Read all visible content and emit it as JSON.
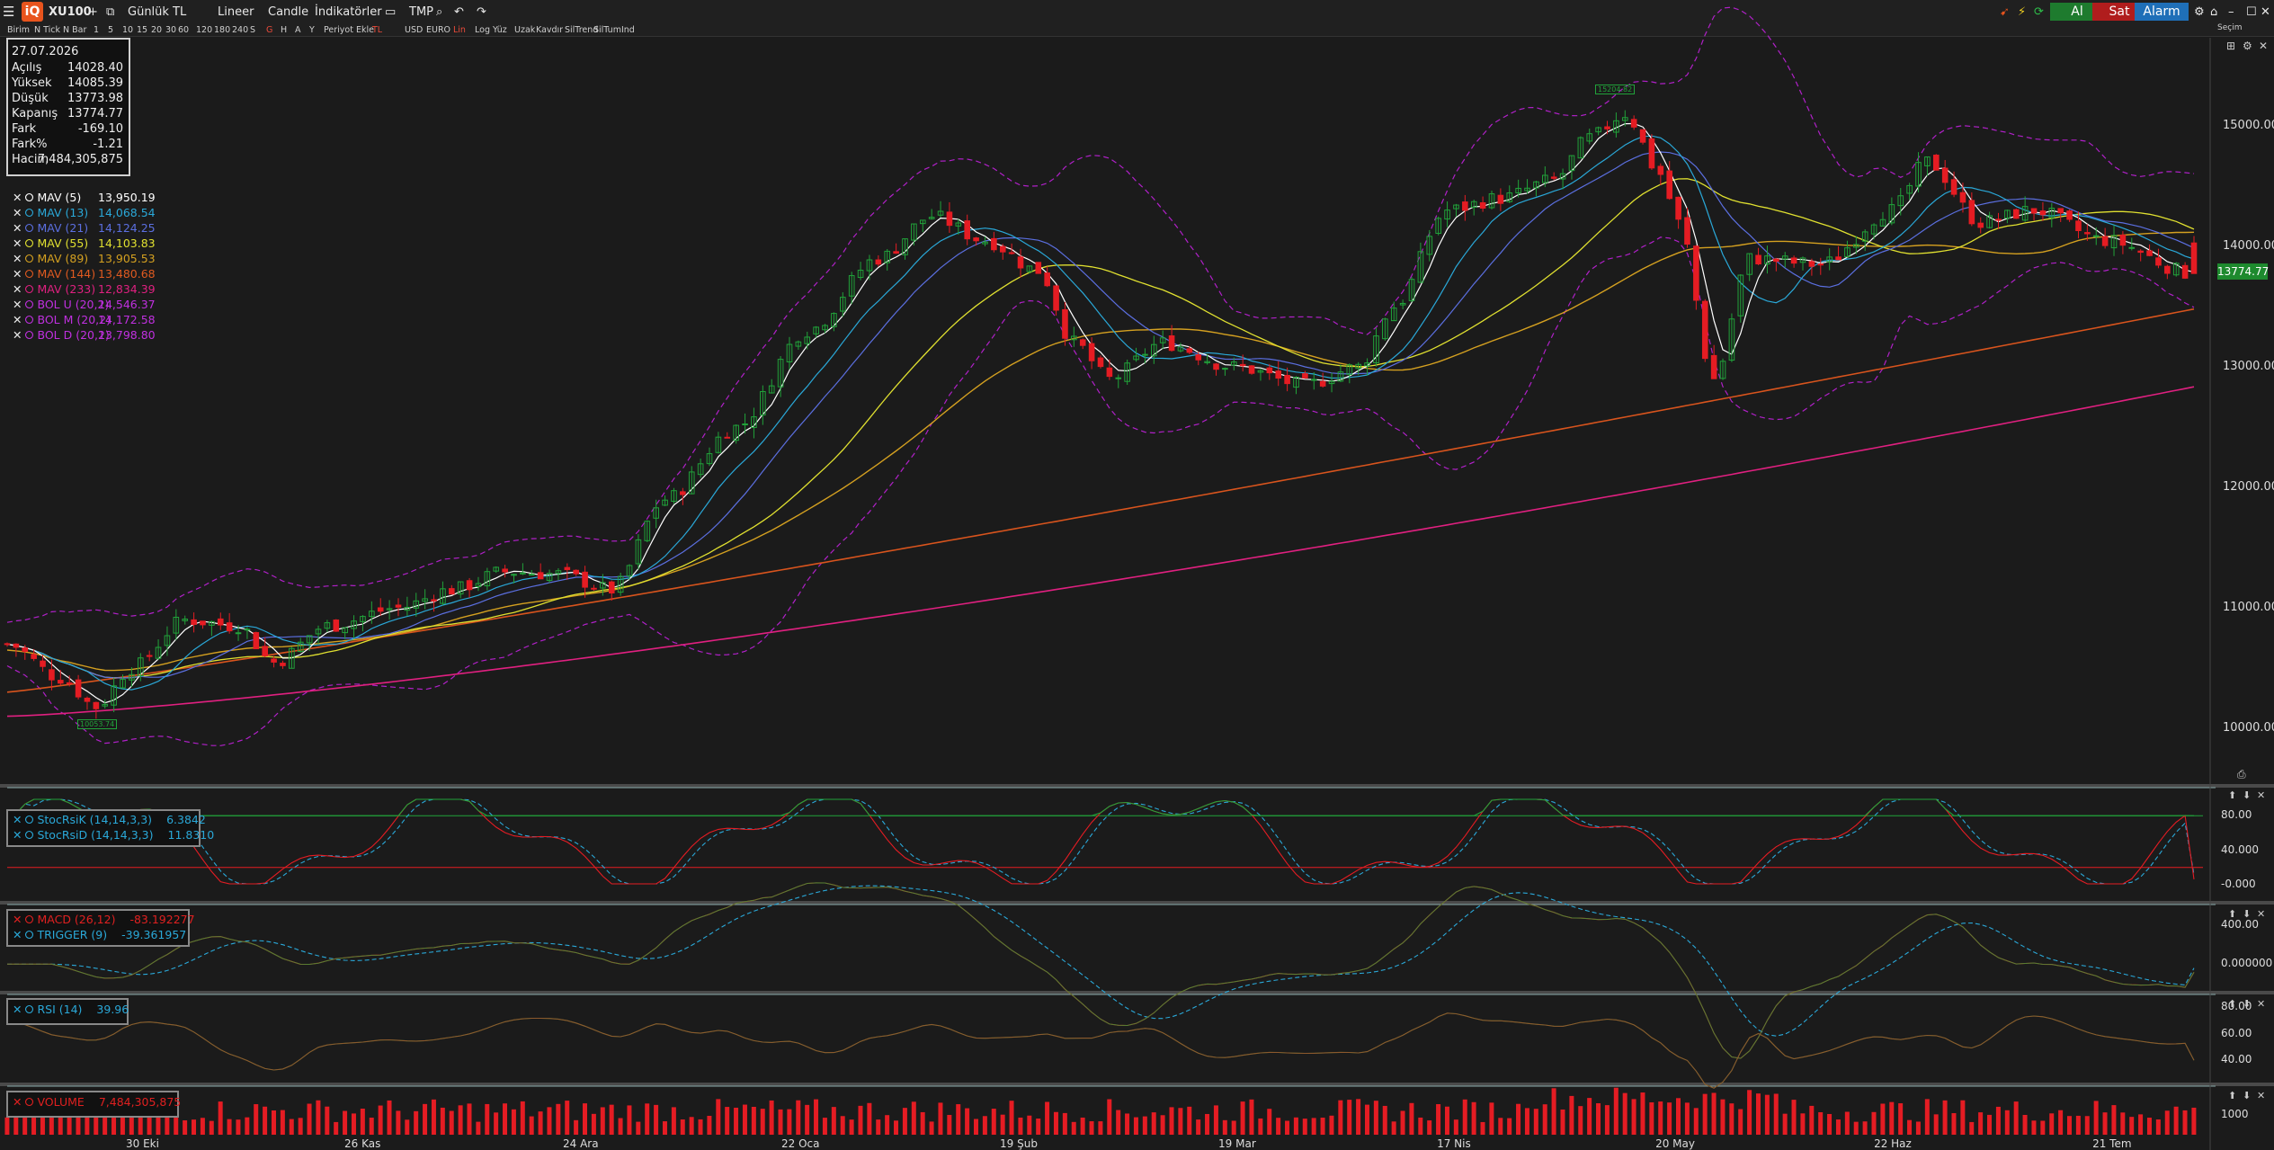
{
  "toolbar": {
    "symbol": "XU100",
    "period": "Günlük",
    "currency": "TL",
    "scale": "Lineer",
    "chart_type": "Candle",
    "indicators": "İndikatörler",
    "tmp": "TMP",
    "buy": "Al",
    "sell": "Sat",
    "alarm": "Alarm",
    "settings_label": "Seçim",
    "row2": [
      "Birim",
      "N Tick",
      "N Bar",
      "1",
      "5",
      "10",
      "15",
      "20",
      "30",
      "60",
      "120",
      "180",
      "240",
      "S",
      "G",
      "H",
      "A",
      "Y",
      "Periyot Ekle",
      "TL",
      "USD",
      "EURO",
      "Lin",
      "Log",
      "Yüz",
      "Uzak",
      "Kavdır",
      "SilTrend",
      "SilTumInd"
    ]
  },
  "info_box": {
    "date": "27.07.2026",
    "rows": [
      {
        "label": "Açılış",
        "value": "14028.40"
      },
      {
        "label": "Yüksek",
        "value": "14085.39"
      },
      {
        "label": "Düşük",
        "value": "13773.98"
      },
      {
        "label": "Kapanış",
        "value": "13774.77"
      },
      {
        "label": "Fark",
        "value": "-169.10"
      },
      {
        "label": "Fark%",
        "value": "-1.21"
      },
      {
        "label": "Hacim",
        "value": "7,484,305,875"
      }
    ]
  },
  "main_legend": [
    {
      "name": "MAV (5)",
      "value": "13,950.19",
      "color": "#ffffff"
    },
    {
      "name": "MAV (13)",
      "value": "14,068.54",
      "color": "#2aa8d8"
    },
    {
      "name": "MAV (21)",
      "value": "14,124.25",
      "color": "#5b6fe0"
    },
    {
      "name": "MAV (55)",
      "value": "14,103.83",
      "color": "#e0e030"
    },
    {
      "name": "MAV (89)",
      "value": "13,905.53",
      "color": "#d4a020"
    },
    {
      "name": "MAV (144)",
      "value": "13,480.68",
      "color": "#e05a20"
    },
    {
      "name": "MAV (233)",
      "value": "12,834.39",
      "color": "#e02080"
    },
    {
      "name": "BOL U (20,2)",
      "value": "14,546.37",
      "color": "#c030e0"
    },
    {
      "name": "BOL M (20,2)",
      "value": "14,172.58",
      "color": "#c030e0"
    },
    {
      "name": "BOL D (20,2)",
      "value": "13,798.80",
      "color": "#c030e0"
    }
  ],
  "price_axis": [
    "15000.00",
    "14000.00",
    "13000.00",
    "12000.00",
    "11000.00",
    "10000.00"
  ],
  "last_price": "13774.77",
  "high_marker": "15204.82",
  "low_marker": "10053.74",
  "x_axis": [
    "30 Eki",
    "26 Kas",
    "24 Ara",
    "22 Oca",
    "19 Şub",
    "19 Mar",
    "17 Nis",
    "20 May",
    "22 Haz",
    "21 Tem"
  ],
  "stoch_legend": [
    {
      "name": "StocRsiK (14,14,3,3)",
      "value": "6.3842",
      "color": "#2aa8d8"
    },
    {
      "name": "StocRsiD (14,14,3,3)",
      "value": "11.8310",
      "color": "#2aa8d8"
    }
  ],
  "stoch_axis": [
    "80.00",
    "40.000",
    "-0.000"
  ],
  "macd_legend": [
    {
      "name": "MACD (26,12)",
      "value": "-83.192277",
      "color": "#e02020"
    },
    {
      "name": "TRIGGER (9)",
      "value": "-39.361957",
      "color": "#2aa8d8"
    }
  ],
  "macd_axis": [
    "400.00",
    "0.000000"
  ],
  "rsi_legend": {
    "name": "RSI (14)",
    "value": "39.96",
    "color": "#2aa8d8"
  },
  "rsi_axis": [
    "80.00",
    "60.00",
    "40.00"
  ],
  "vol_legend": {
    "name": "VOLUME",
    "value": "7,484,305,875",
    "color": "#e02020"
  },
  "vol_axis": [
    "1000"
  ],
  "colors": {
    "up": "#21a33a",
    "down": "#e51c23",
    "bg": "#1b1b1b"
  }
}
